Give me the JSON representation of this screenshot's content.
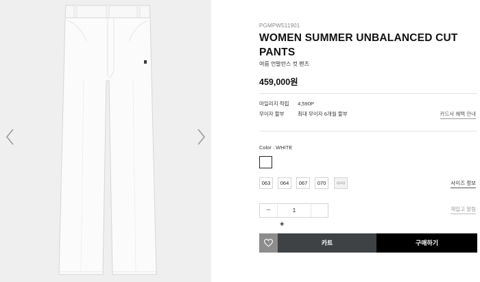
{
  "product": {
    "code": "PGMPW511901",
    "title": "WOMEN SUMMER UNBALANCED CUT PANTS",
    "subtitle": "여름 언발란스 컷 팬츠",
    "price": "459,000원"
  },
  "info": {
    "mileage_label": "마일리지 적립",
    "mileage_value": "4,590P",
    "installment_label": "무이자 할부",
    "installment_value": "최대 무이자 6개월 할부",
    "card_benefit_link": "카드사 혜택 안내"
  },
  "options": {
    "color_label": "Color : WHITE",
    "selected_color": "#ffffff",
    "sizes": [
      {
        "label": "063",
        "available": true
      },
      {
        "label": "064",
        "available": true
      },
      {
        "label": "067",
        "available": true
      },
      {
        "label": "070",
        "available": true
      },
      {
        "label": "073",
        "available": false
      }
    ],
    "size_guide_link": "사이즈 정보"
  },
  "quantity": {
    "minus": "–",
    "value": "1",
    "plus": "+",
    "restock_link": "재입고 알림"
  },
  "actions": {
    "wishlist_icon": "heart-icon",
    "cart_label": "카트",
    "buy_label": "구매하기"
  },
  "gallery": {
    "prev_icon": "chevron-left-icon",
    "next_icon": "chevron-right-icon"
  },
  "colors": {
    "gallery_bg": "#efefef",
    "cart_bg": "#3e4245",
    "buy_bg": "#000000",
    "wish_bg": "#8d8d8d"
  }
}
